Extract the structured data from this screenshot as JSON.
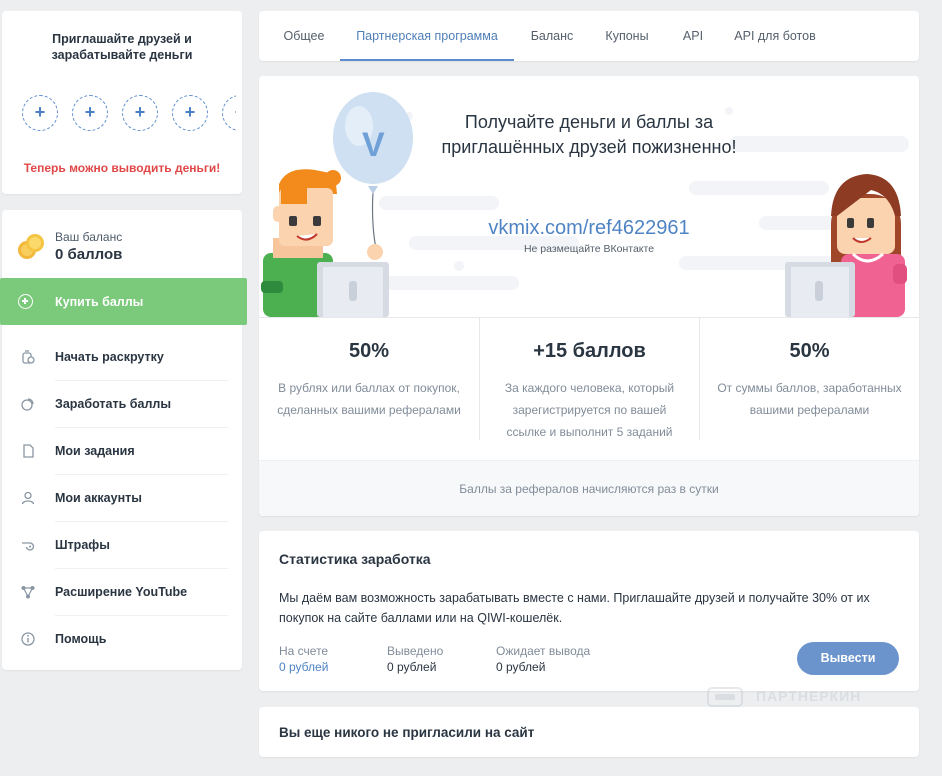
{
  "invite": {
    "title_line1": "Приглашайте друзей и",
    "title_line2": "зарабатывайте деньги",
    "slot_symbol": "+",
    "message": "Теперь можно выводить деньги!"
  },
  "sidebar": {
    "balance_label": "Ваш баланс",
    "balance_value": "0 баллов",
    "buy_label": "Купить баллы",
    "items": [
      {
        "label": "Начать раскрутку",
        "icon": "rocket-icon"
      },
      {
        "label": "Заработать баллы",
        "icon": "coins-icon"
      },
      {
        "label": "Мои задания",
        "icon": "document-icon"
      },
      {
        "label": "Мои аккаунты",
        "icon": "user-icon"
      },
      {
        "label": "Штрафы",
        "icon": "whistle-icon"
      },
      {
        "label": "Расширение YouTube",
        "icon": "share-icon"
      },
      {
        "label": "Помощь",
        "icon": "info-icon"
      }
    ]
  },
  "tabs": [
    {
      "label": "Общее",
      "active": false
    },
    {
      "label": "Партнерская программа",
      "active": true
    },
    {
      "label": "Баланс",
      "active": false
    },
    {
      "label": "Купоны",
      "active": false
    },
    {
      "label": "API",
      "active": false
    },
    {
      "label": "API для ботов",
      "active": false
    }
  ],
  "hero": {
    "headline_line1": "Получайте деньги и баллы за",
    "headline_line2": "приглашённых друзей пожизненно!",
    "balloon_letter": "V",
    "ref_link": "vkmix.com/ref4622961",
    "ref_note": "Не размещайте ВКонтакте"
  },
  "stats": [
    {
      "value": "50%",
      "desc": "В рублях или баллах от покупок, сделанных вашими рефералами"
    },
    {
      "value": "+15 баллов",
      "desc": "За каждого человека, который зарегистрируется по вашей ссылке и выполнит 5 заданий"
    },
    {
      "value": "50%",
      "desc": "От суммы баллов, заработанных вашими рефералами"
    }
  ],
  "stats_footer": "Баллы за рефералов начисляются раз в сутки",
  "earnings": {
    "title": "Статистика заработка",
    "text": "Мы даём вам возможность зарабатывать вместе с нами. Приглашайте друзей и получайте 30% от их покупок на сайте баллами или на QIWI-кошелёк.",
    "on_account_label": "На счете",
    "on_account_value": "0 рублей",
    "withdrawn_label": "Выведено",
    "withdrawn_value": "0 рублей",
    "pending_label": "Ожидает вывода",
    "pending_value": "0 рублей",
    "withdraw_button": "Вывести"
  },
  "no_invites": "Вы еще никого не пригласили на сайт",
  "watermark": "ПАРТНЕРКИН",
  "colors": {
    "accent": "#5b8ccf",
    "buy_green": "#7bc97b",
    "alert_red": "#e04848",
    "button_blue": "#6b94cc"
  }
}
